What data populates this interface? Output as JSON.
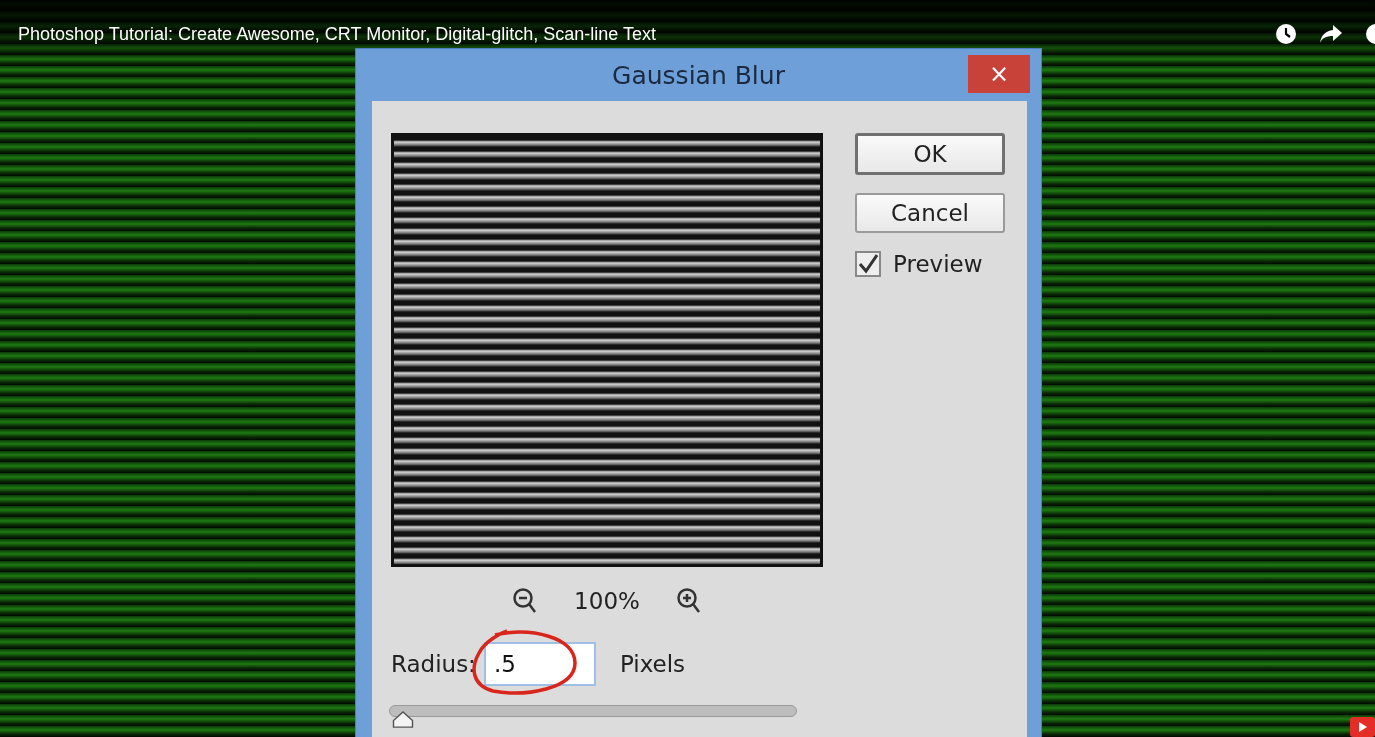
{
  "video": {
    "title": "Photoshop Tutorial: Create Awesome, CRT Monitor, Digital-glitch, Scan-line Text"
  },
  "dialog": {
    "title": "Gaussian Blur",
    "close": "×",
    "buttons": [
      "OK",
      "Cancel"
    ],
    "preview_checkbox": {
      "label": "Preview",
      "checked": true
    },
    "zoom": "100%",
    "radius": {
      "label": "Radius:",
      "value": ".5",
      "unit": "Pixels",
      "level": 0.01,
      "annotated": true
    }
  }
}
